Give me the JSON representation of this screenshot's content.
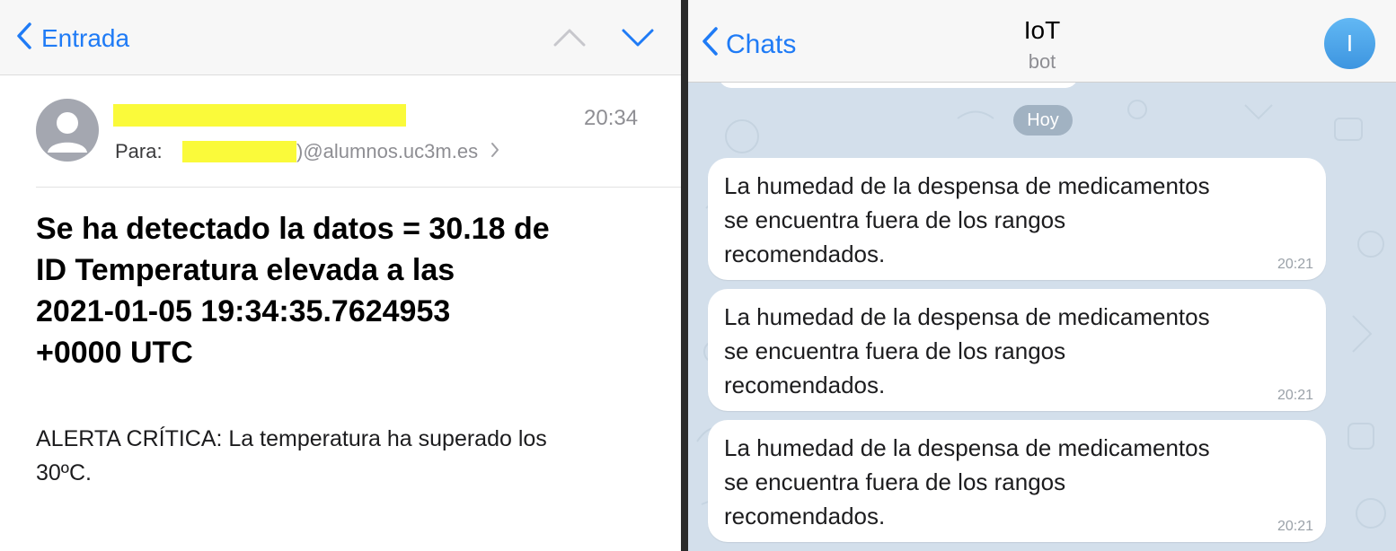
{
  "mail": {
    "nav": {
      "back_label": "Entrada",
      "prev_icon": "chevron-up-icon",
      "next_icon": "chevron-down-icon"
    },
    "message": {
      "time": "20:34",
      "to_label": "Para:",
      "to_domain": ")@alumnos.uc3m.es",
      "subject": "Se ha detectado la datos = 30.18 de\nID  Temperatura elevada a las\n2021-01-05 19:34:35.7624953\n+0000 UTC",
      "body": "ALERTA CRÍTICA: La temperatura ha superado los\n30ºC."
    }
  },
  "telegram": {
    "header": {
      "back_label": "Chats",
      "title": "IoT",
      "subtitle": "bot",
      "avatar_letter": "I"
    },
    "date_separator": "Hoy",
    "messages": [
      {
        "text": "La humedad de la despensa de medicamentos\nse encuentra fuera de los rangos\nrecomendados.",
        "time": "20:21"
      },
      {
        "text": "La humedad de la despensa de medicamentos\nse encuentra fuera de los rangos\nrecomendados.",
        "time": "20:21"
      },
      {
        "text": "La humedad de la despensa de medicamentos\nse encuentra fuera de los rangos\nrecomendados.",
        "time": "20:21"
      }
    ]
  },
  "colors": {
    "ios_blue": "#1f7bf6",
    "redaction_yellow": "#fafa3a",
    "telegram_bg": "#d3dfeb",
    "avatar_blue": "#3d95e0"
  }
}
